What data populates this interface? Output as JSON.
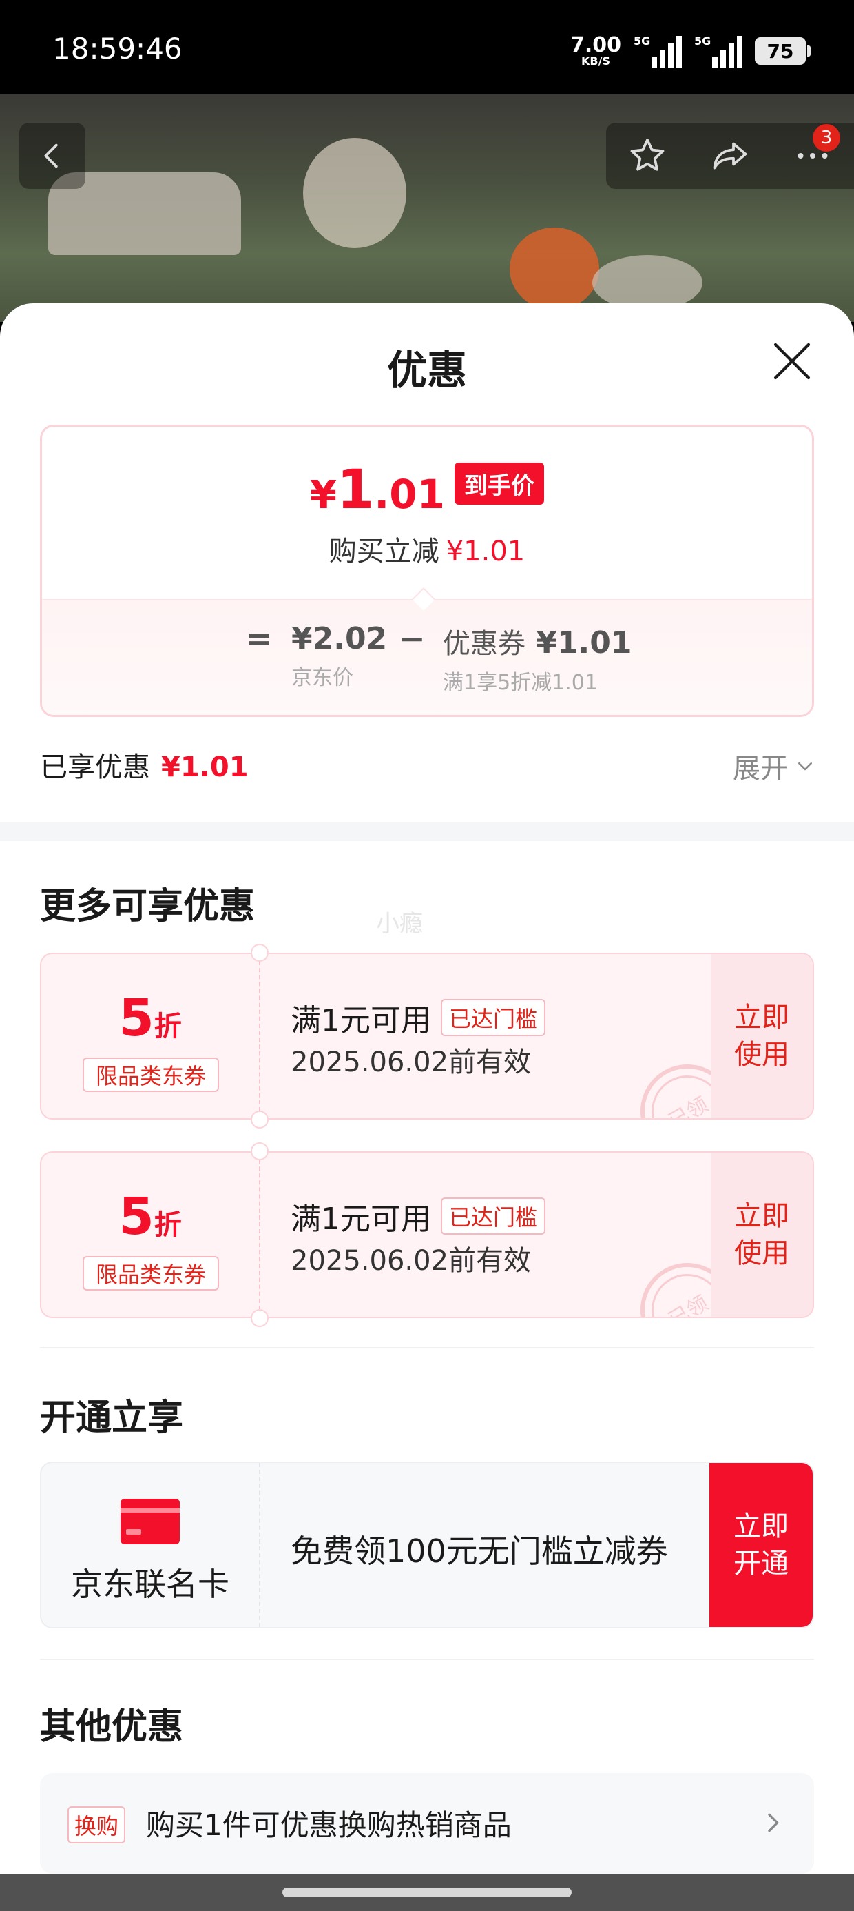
{
  "status_bar": {
    "time": "18:59:46",
    "net_speed": "7.00",
    "net_unit": "KB/S",
    "signal1_label": "5G",
    "signal2_label": "5G",
    "battery": "75"
  },
  "top_nav": {
    "back_icon": "chevron-left-icon",
    "favorite_icon": "star-icon",
    "share_icon": "share-icon",
    "more_icon": "more-dots-icon",
    "badge_count": "3"
  },
  "sheet": {
    "title": "优惠",
    "close_icon": "close-icon"
  },
  "summary": {
    "price_symbol": "¥",
    "price_int": "1",
    "price_dec": ".01",
    "price_tag": "到手价",
    "reduce_label": "购买立减",
    "reduce_amount": "¥1.01",
    "eq": "=",
    "jd_price": "¥2.02",
    "jd_price_label": "京东价",
    "minus": "−",
    "coupon_label": "优惠券",
    "coupon_amount": "¥1.01",
    "coupon_desc": "满1享5折减1.01"
  },
  "enjoyed": {
    "label": "已享优惠",
    "amount": "¥1.01",
    "expand_label": "展开"
  },
  "more_offers": {
    "title": "更多可享优惠",
    "watermark": "小瘾",
    "coupons": [
      {
        "rate": "5",
        "unit": "折",
        "type": "限品类东券",
        "condition": "满1元可用",
        "tag": "已达门槛",
        "valid": "2025.06.02前有效",
        "action": "立即使用",
        "stamp": "已领"
      },
      {
        "rate": "5",
        "unit": "折",
        "type": "限品类东券",
        "condition": "满1元可用",
        "tag": "已达门槛",
        "valid": "2025.06.02前有效",
        "action": "立即使用",
        "stamp": "已领"
      }
    ]
  },
  "open_section": {
    "title": "开通立享",
    "card_icon": "credit-card-icon",
    "card_name": "京东联名卡",
    "desc": "免费领100元无门槛立减券",
    "action": "立即开通"
  },
  "other_offers": {
    "title": "其他优惠",
    "tag": "换购",
    "text": "购买1件可优惠换购热销商品"
  },
  "colors": {
    "accent_red": "#f2102a",
    "coupon_bg": "#fff3f5"
  }
}
